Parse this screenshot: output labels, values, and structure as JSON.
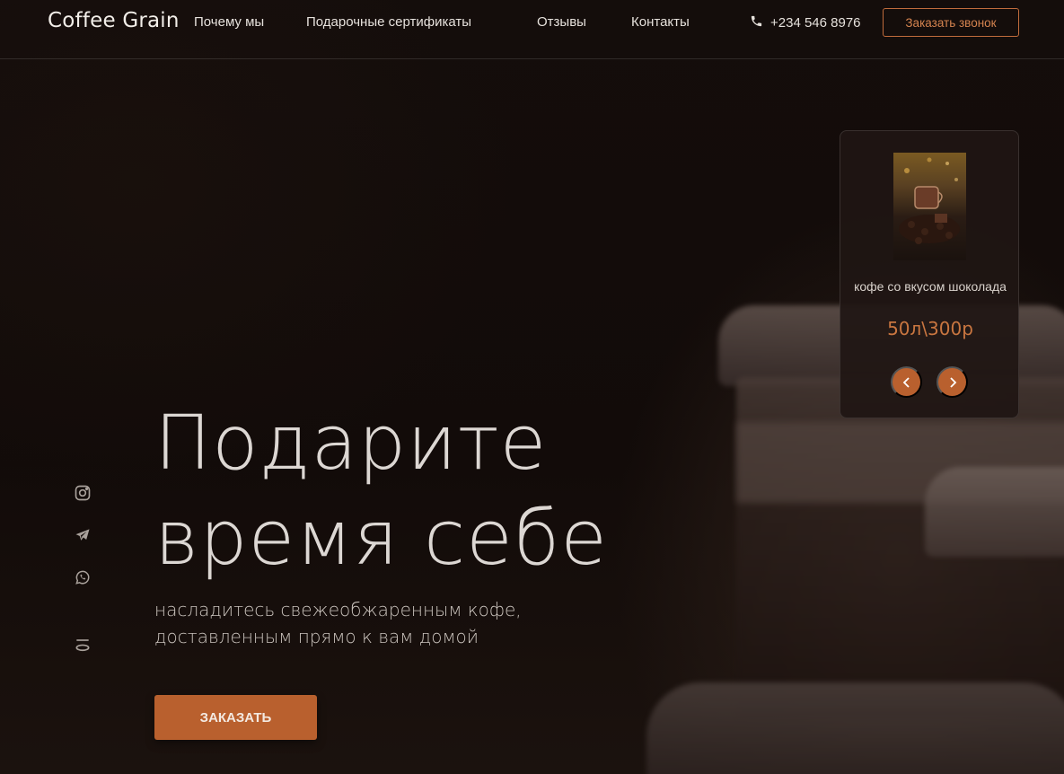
{
  "header": {
    "logo": "Coffee Grain",
    "nav": [
      "Почему мы",
      "Подарочные сертификаты",
      "Отзывы",
      "Контакты"
    ],
    "phone": "+234 546 8976",
    "callback_label": "Заказать звонок"
  },
  "hero": {
    "title_line1": "Подарите",
    "title_line2": "время себе",
    "subtitle_line1": "насладитесь свежеобжаренным кофе,",
    "subtitle_line2": "доставленным прямо к вам домой",
    "order_label": "ЗАКАЗАТЬ"
  },
  "social": [
    "instagram-icon",
    "telegram-icon",
    "whatsapp-icon",
    "yandex-icon"
  ],
  "card": {
    "product_name": "кофе со вкусом шоколада",
    "price": "50л\\300р"
  },
  "colors": {
    "accent": "#b9602e",
    "background": "#100a08",
    "text": "#e6e1dc"
  }
}
